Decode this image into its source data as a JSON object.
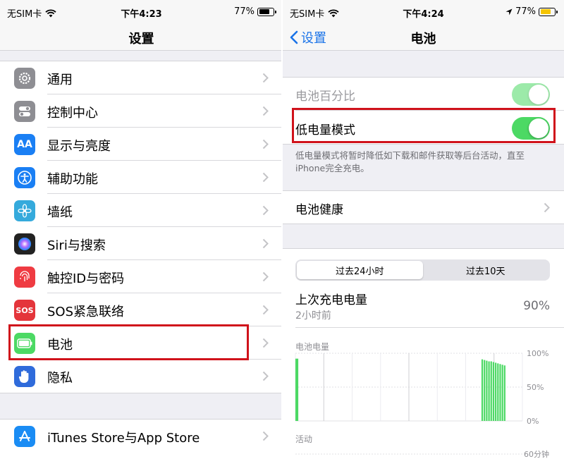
{
  "left": {
    "status_bar": {
      "carrier": "无SIM卡",
      "time": "下午4:23",
      "battery": "77%"
    },
    "nav_title": "设置",
    "items": [
      {
        "label": "通用",
        "icon": "gear-icon",
        "color": "#8e8e93"
      },
      {
        "label": "控制中心",
        "icon": "toggles-icon",
        "color": "#8e8e93"
      },
      {
        "label": "显示与亮度",
        "icon": "text-size-icon",
        "color": "#1a7ff4",
        "glyph": "AA"
      },
      {
        "label": "辅助功能",
        "icon": "accessibility-icon",
        "color": "#1a7ff4"
      },
      {
        "label": "墙纸",
        "icon": "flower-icon",
        "color": "#35aadc"
      },
      {
        "label": "Siri与搜索",
        "icon": "siri-icon",
        "color": "#222222"
      },
      {
        "label": "触控ID与密码",
        "icon": "fingerprint-icon",
        "color": "#ef3b42"
      },
      {
        "label": "SOS紧急联络",
        "icon": "sos-icon",
        "color": "#e4353b",
        "glyph": "SOS"
      },
      {
        "label": "电池",
        "icon": "battery-icon",
        "color": "#4cd964"
      },
      {
        "label": "隐私",
        "icon": "hand-icon",
        "color": "#2f6bdb"
      }
    ],
    "store_item": {
      "label": "iTunes Store与App Store",
      "icon": "app-store-icon",
      "color": "#1a8cf4"
    }
  },
  "right": {
    "status_bar": {
      "carrier": "无SIM卡",
      "time": "下午4:24",
      "battery": "77%"
    },
    "back_label": "设置",
    "nav_title": "电池",
    "battery_percentage_label": "电池百分比",
    "low_power_label": "低电量模式",
    "footnote": "低电量模式将暂时降低如下载和邮件获取等后台活动，直至iPhone完全充电。",
    "battery_health_label": "电池健康",
    "segments": [
      "过去24小时",
      "过去10天"
    ],
    "last_charge_title": "上次充电电量",
    "last_charge_subtitle": "2小时前",
    "last_charge_value": "90%",
    "accent_color": "#4cd964",
    "highlight_color": "#d0121b"
  },
  "chart_data": {
    "type": "bar",
    "title": "电池电量",
    "y_ticks": [
      "100%",
      "50%",
      "0%"
    ],
    "ylim": [
      0,
      100
    ],
    "activity_label": "活动",
    "activity_tick": "60分钟",
    "bars": [
      {
        "x": 0.0,
        "value": 92
      },
      {
        "x": 0.006,
        "value": 92
      },
      {
        "x": 0.83,
        "value": 91
      },
      {
        "x": 0.84,
        "value": 90
      },
      {
        "x": 0.85,
        "value": 89
      },
      {
        "x": 0.86,
        "value": 88
      },
      {
        "x": 0.87,
        "value": 88
      },
      {
        "x": 0.88,
        "value": 87
      },
      {
        "x": 0.89,
        "value": 86
      },
      {
        "x": 0.9,
        "value": 85
      },
      {
        "x": 0.91,
        "value": 84
      },
      {
        "x": 0.92,
        "value": 83
      },
      {
        "x": 0.93,
        "value": 82
      }
    ]
  }
}
